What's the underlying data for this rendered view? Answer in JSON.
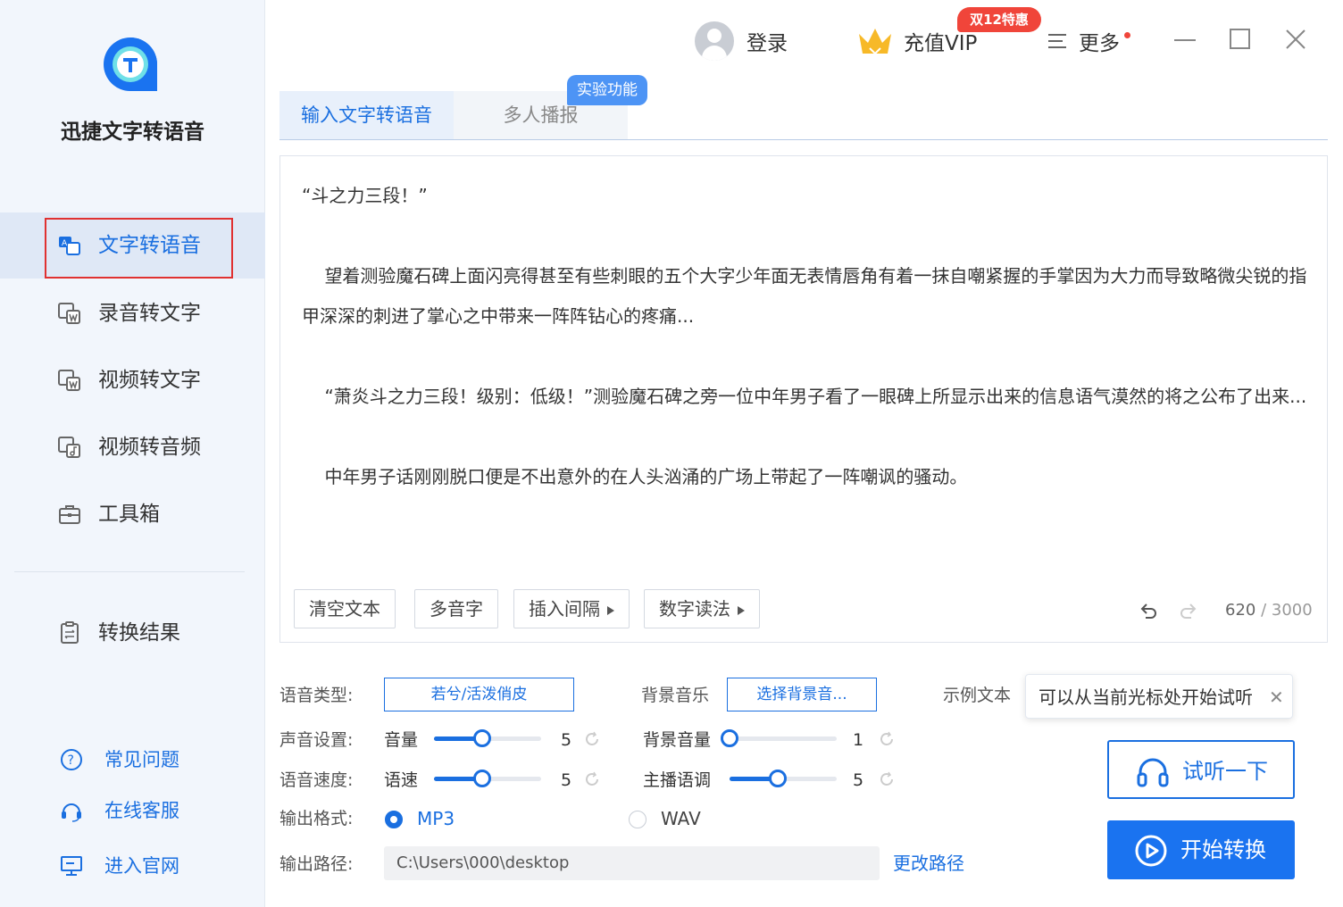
{
  "app": {
    "name": "迅捷文字转语音"
  },
  "sidebar": {
    "items": [
      {
        "label": "文字转语音",
        "icon": "text-to-speech-icon",
        "active": true
      },
      {
        "label": "录音转文字",
        "icon": "audio-to-text-icon"
      },
      {
        "label": "视频转文字",
        "icon": "video-to-text-icon"
      },
      {
        "label": "视频转音频",
        "icon": "video-to-audio-icon"
      },
      {
        "label": "工具箱",
        "icon": "toolbox-icon"
      }
    ],
    "result": {
      "label": "转换结果",
      "icon": "clipboard-icon"
    },
    "help": [
      {
        "label": "常见问题",
        "icon": "question-icon"
      },
      {
        "label": "在线客服",
        "icon": "headset-icon"
      },
      {
        "label": "进入官网",
        "icon": "monitor-icon"
      }
    ]
  },
  "topbar": {
    "login": "登录",
    "vip": "充值VIP",
    "vip_badge": "双12特惠",
    "more": "更多"
  },
  "tabs": {
    "items": [
      "输入文字转语音",
      "多人播报"
    ],
    "experiment_badge": "实验功能"
  },
  "editor": {
    "text": "“斗之力三段！”\n\n    望着测验魔石碑上面闪亮得甚至有些刺眼的五个大字少年面无表情唇角有着一抹自嘲紧握的手掌因为大力而导致略微尖锐的指甲深深的刺进了掌心之中带来一阵阵钻心的疼痛...\n\n    “萧炎斗之力三段！级别：低级！”测验魔石碑之旁一位中年男子看了一眼碑上所显示出来的信息语气漠然的将之公布了出来...\n\n    中年男子话刚刚脱口便是不出意外的在人头汹涌的广场上带起了一阵嘲讽的骚动。",
    "tools": {
      "clear": "清空文本",
      "polyphone": "多音字",
      "insert_pause": "插入间隔",
      "number_reading": "数字读法"
    },
    "char_count": "620",
    "char_max": "3000"
  },
  "settings": {
    "voice_type_label": "语音类型:",
    "voice_type_value": "若兮/活泼俏皮",
    "bgm_label": "背景音乐",
    "bgm_button": "选择背景音...",
    "sample_label": "示例文本",
    "sample_popup": "可以从当前光标处开始试听",
    "sound_label": "声音设置:",
    "volume_label": "音量",
    "volume_value": "5",
    "bg_volume_label": "背景音量",
    "bg_volume_value": "1",
    "speed_label": "语音速度:",
    "rate_label": "语速",
    "rate_value": "5",
    "pitch_label": "主播语调",
    "pitch_value": "5",
    "format_label": "输出格式:",
    "format_options": [
      "MP3",
      "WAV"
    ],
    "format_selected": "MP3",
    "path_label": "输出路径:",
    "path_value": "C:\\Users\\000\\desktop",
    "change_path": "更改路径"
  },
  "actions": {
    "listen": "试听一下",
    "convert": "开始转换"
  },
  "colors": {
    "accent": "#1a6fe0",
    "badge_red": "#f0453a",
    "sidebar_bg": "#f2f6fc"
  }
}
